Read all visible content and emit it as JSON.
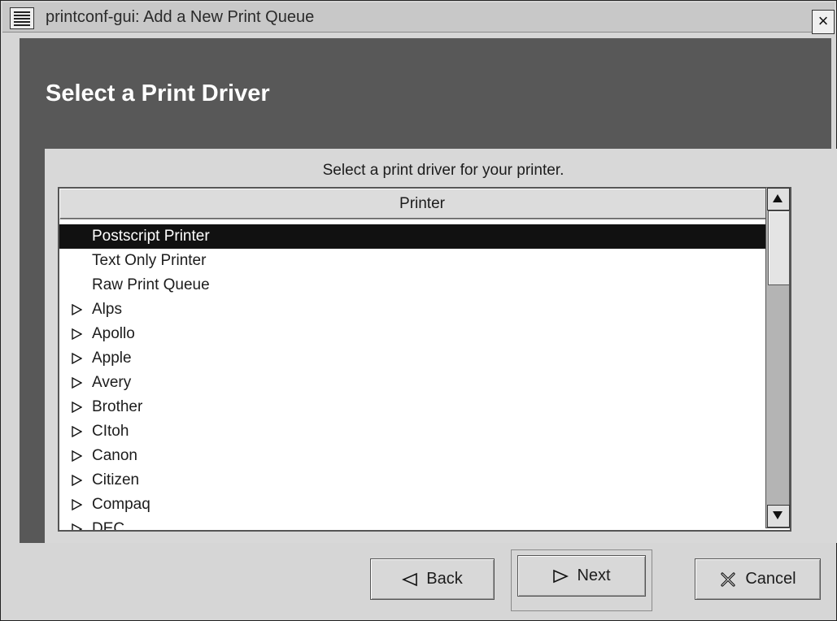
{
  "window": {
    "title": "printconf-gui: Add a New Print Queue",
    "close_label": "×"
  },
  "druid": {
    "title": "Select a Print Driver",
    "prompt": "Select a print driver for your printer."
  },
  "list": {
    "column_header": "Printer",
    "rows": [
      {
        "label": "Postscript Printer",
        "expandable": false,
        "selected": true
      },
      {
        "label": "Text Only Printer",
        "expandable": false,
        "selected": false
      },
      {
        "label": "Raw Print Queue",
        "expandable": false,
        "selected": false
      },
      {
        "label": "Alps",
        "expandable": true,
        "selected": false
      },
      {
        "label": "Apollo",
        "expandable": true,
        "selected": false
      },
      {
        "label": "Apple",
        "expandable": true,
        "selected": false
      },
      {
        "label": "Avery",
        "expandable": true,
        "selected": false
      },
      {
        "label": "Brother",
        "expandable": true,
        "selected": false
      },
      {
        "label": "CItoh",
        "expandable": true,
        "selected": false
      },
      {
        "label": "Canon",
        "expandable": true,
        "selected": false
      },
      {
        "label": "Citizen",
        "expandable": true,
        "selected": false
      },
      {
        "label": "Compaq",
        "expandable": true,
        "selected": false
      },
      {
        "label": "DEC",
        "expandable": true,
        "selected": false
      }
    ]
  },
  "buttons": {
    "back": "Back",
    "next": "Next",
    "cancel": "Cancel"
  },
  "icons": {
    "window_menu": "window-menu-icon",
    "close": "close-icon",
    "expander": "triangle-right-icon",
    "back": "triangle-left-icon",
    "next": "triangle-right-icon",
    "cancel": "cancel-x-icon",
    "scroll_up": "arrow-up-icon",
    "scroll_down": "arrow-down-icon"
  },
  "colors": {
    "druid_background": "#585858",
    "selection": "#111111"
  }
}
